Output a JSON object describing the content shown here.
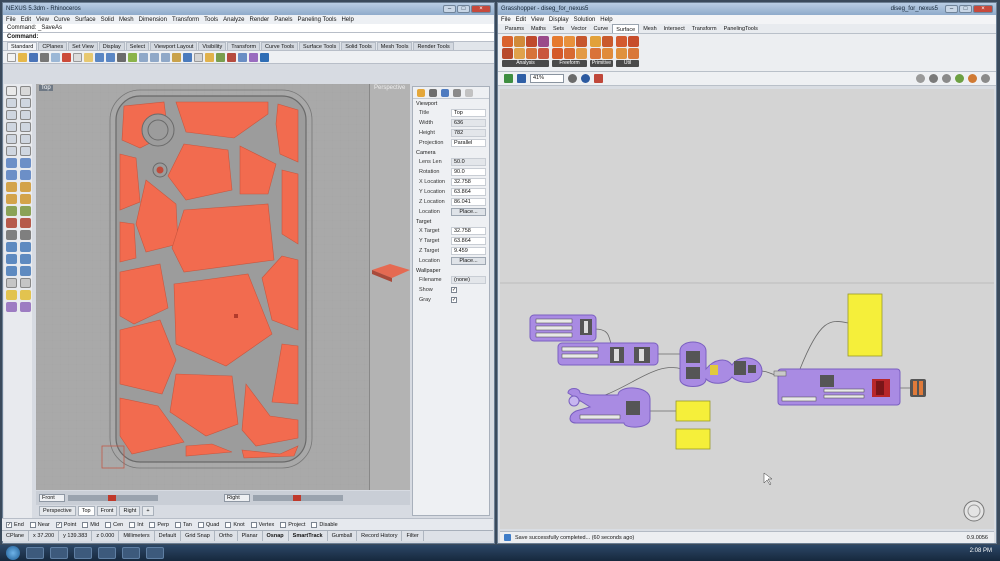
{
  "rhino": {
    "title": "NEXUS 5.3dm - Rhinoceros",
    "menu": [
      "File",
      "Edit",
      "View",
      "Curve",
      "Surface",
      "Solid",
      "Mesh",
      "Dimension",
      "Transform",
      "Tools",
      "Analyze",
      "Render",
      "Panels",
      "Paneling Tools",
      "Help"
    ],
    "command_history": "Command: _SaveAs",
    "command_prompt": "Command:",
    "toolbar_tabs": [
      "Standard",
      "CPlanes",
      "Set View",
      "Display",
      "Select",
      "Viewport Layout",
      "Visibility",
      "Transform",
      "Curve Tools",
      "Surface Tools",
      "Solid Tools",
      "Mesh Tools",
      "Render Tools"
    ],
    "viewport_top_label": "Top",
    "viewport_persp_label": "Perspective",
    "properties": {
      "viewport_section": "Viewport",
      "title_label": "Title",
      "title_value": "Top",
      "width_label": "Width",
      "width_value": "636",
      "height_label": "Height",
      "height_value": "782",
      "projection_label": "Projection",
      "projection_value": "Parallel",
      "camera_section": "Camera",
      "lens_label": "Lens Len",
      "lens_value": "50.0",
      "rotation_label": "Rotation",
      "rotation_value": "90.0",
      "xloc_label": "X Location",
      "xloc_value": "32.758",
      "yloc_label": "Y Location",
      "yloc_value": "63.864",
      "zloc_label": "Z Location",
      "zloc_value": "86.041",
      "location_label": "Location",
      "place_label": "Place...",
      "target_section": "Target",
      "xt_label": "X Target",
      "xt_value": "32.758",
      "yt_label": "Y Target",
      "yt_value": "63.864",
      "zt_label": "Z Target",
      "zt_value": "9.459",
      "wallpaper_section": "Wallpaper",
      "filename_label": "Filename",
      "filename_value": "(none)",
      "show_label": "Show",
      "gray_label": "Gray"
    },
    "bottom_views": [
      "Front",
      "Right"
    ],
    "view_tabs": [
      "Perspective",
      "Top",
      "Front",
      "Right"
    ],
    "osnaps": [
      "End",
      "Near",
      "Point",
      "Mid",
      "Cen",
      "Int",
      "Perp",
      "Tan",
      "Quad",
      "Knot",
      "Vertex",
      "Project",
      "Disable"
    ],
    "status": {
      "cplane": "CPlane",
      "x": "x 37.200",
      "y": "y 139.383",
      "z": "z 0.000",
      "units": "Millimeters",
      "layer": "Default",
      "grid_snap": "Grid Snap",
      "ortho": "Ortho",
      "planar": "Planar",
      "osnap": "Osnap",
      "smarttrack": "SmartTrack",
      "gumball": "Gumball",
      "history": "Record History",
      "filter": "Filter"
    }
  },
  "grasshopper": {
    "title": "Grasshopper - diseg_for_nexus5",
    "title_right": "diseg_for_nexus5",
    "menu": [
      "File",
      "Edit",
      "View",
      "Display",
      "Solution",
      "Help"
    ],
    "tabs": [
      "Params",
      "Maths",
      "Sets",
      "Vector",
      "Curve",
      "Surface",
      "Mesh",
      "Intersect",
      "Transform",
      "PanelingTools"
    ],
    "active_tab": "Surface",
    "groups": [
      "Analysis",
      "Freeform",
      "Primitive",
      "Util"
    ],
    "zoom": "41%",
    "status_message": "Save successfully completed... (60 seconds ago)",
    "version": "0.9.0056"
  },
  "taskbar": {
    "time": "2:08 PM"
  }
}
